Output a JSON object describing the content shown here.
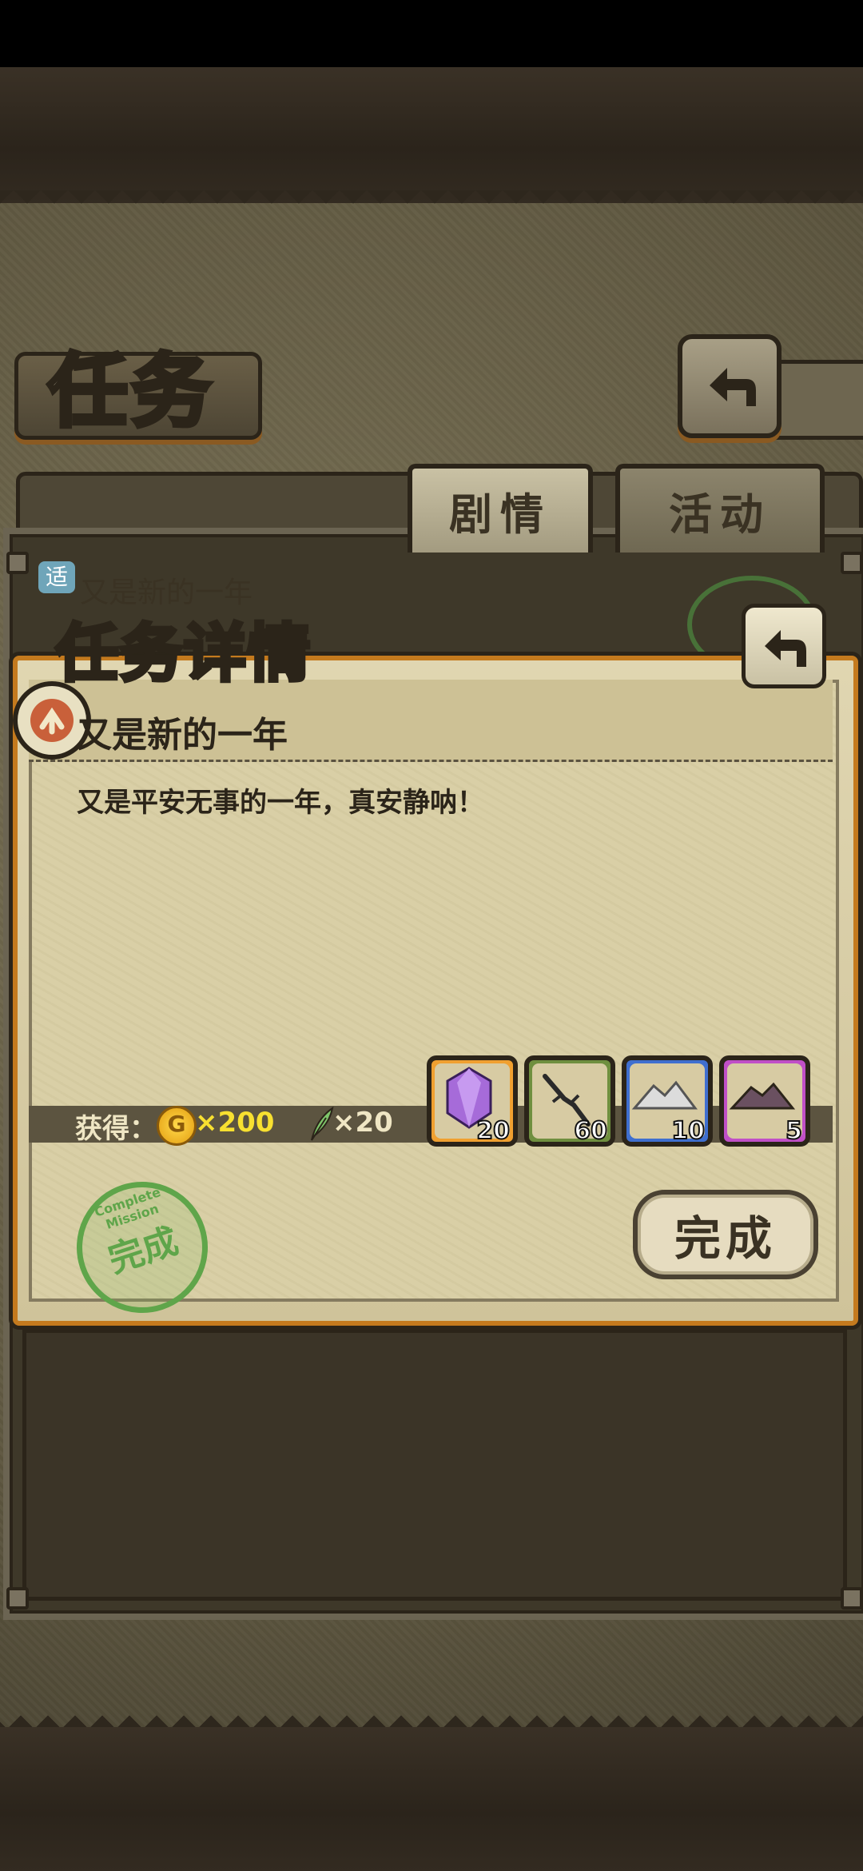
{
  "page": {
    "title": "任务"
  },
  "tabs": [
    {
      "label": "剧情",
      "active": true
    },
    {
      "label": "活动",
      "active": false
    }
  ],
  "quest_list": {
    "items": [
      {
        "badge": "适",
        "title": "又是新的一年"
      }
    ]
  },
  "modal": {
    "title": "任务详情",
    "quest_name": "又是新的一年",
    "description": "又是平安无事的一年，真安静呐！",
    "reward_label": "获得：",
    "coin_icon_text": "G",
    "coin_amount": "×200",
    "feather_amount": "×20",
    "items": [
      {
        "icon": "purple-crystal-icon",
        "count": "20",
        "frame_color": "#f0a030"
      },
      {
        "icon": "dark-branch-icon",
        "count": "60",
        "frame_color": "#6f8f3f"
      },
      {
        "icon": "silver-ore-icon",
        "count": "10",
        "frame_color": "#3f6fcf"
      },
      {
        "icon": "dark-ore-icon",
        "count": "5",
        "frame_color": "#c04fc7"
      }
    ],
    "stamp_text": "完成",
    "stamp_ring_text": "Complete Mission",
    "complete_button": "完成"
  }
}
